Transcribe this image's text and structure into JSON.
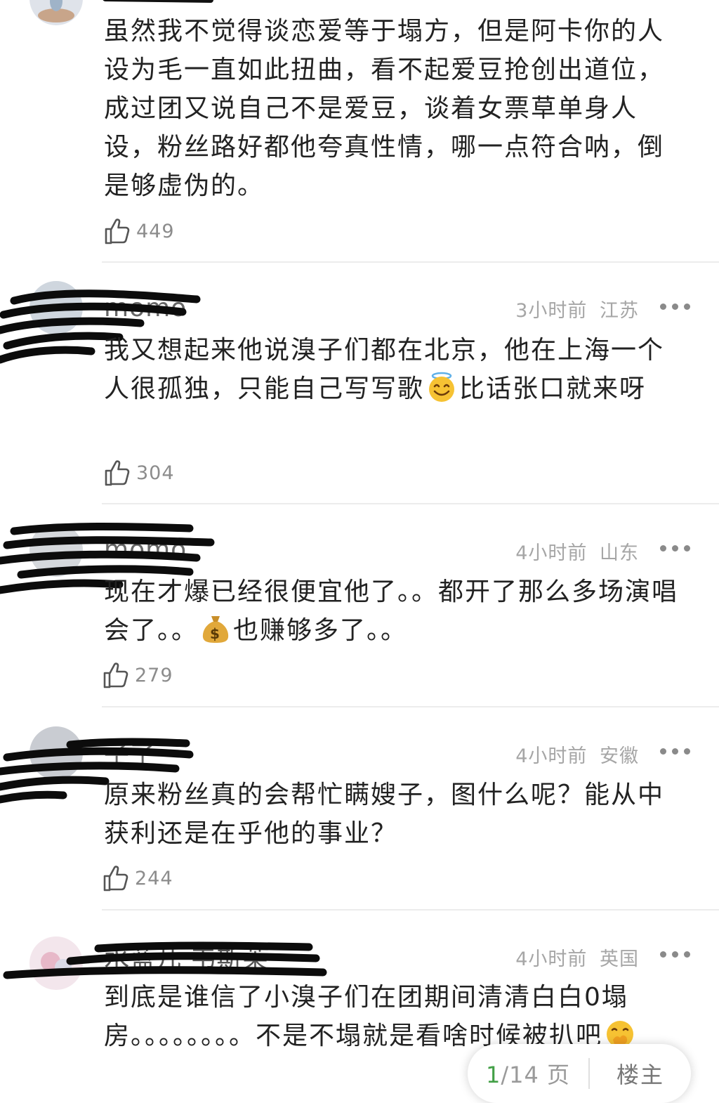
{
  "comments": [
    {
      "text": "虽然我不觉得谈恋爱等于塌方，但是阿卡你的人设为毛一直如此扭曲，看不起爱豆抢创出道位，成过团又说自己不是爱豆，谈着女票草单身人设，粉丝路好都他夸真性情，哪一点符合呐，倒是够虚伪的。",
      "likes": "449"
    },
    {
      "username": "momo",
      "time": "3小时前",
      "location": "江苏",
      "text_before": "我又想起来他说溴子们都在北京，他在上海一个人很孤独，只能自己写写歌",
      "emoji": "smiling-face-with-halo",
      "text_after": "比话张口就来呀",
      "likes": "304"
    },
    {
      "username": "momo",
      "time": "4小时前",
      "location": "山东",
      "text_before": "现在才爆已经很便宜他了。。都开了那么多场演唱会了。。",
      "emoji": "money-bag",
      "text_after": "也赚够多了。。",
      "likes": "279"
    },
    {
      "username": "子了",
      "time": "4小时前",
      "location": "安徽",
      "text": "原来粉丝真的会帮忙瞒嫂子，图什么呢？能从中获利还是在乎他的事业？",
      "likes": "244"
    },
    {
      "username": "水蓝儿 韦斯莱",
      "time": "4小时前",
      "location": "英国",
      "text_before": "到底是谁信了小溴子们在团期间清清白白0塌房。。。。。。。。不是不塌就是看啥时候被扒吧",
      "emoji": "face-with-hand-over-mouth"
    }
  ],
  "pager": {
    "current": "1",
    "total": "/14 页",
    "op_label": "楼主"
  },
  "colors": {
    "accent": "#43a047",
    "meta": "#a6a6a6",
    "divider": "#ececec"
  },
  "icons": [
    "thumbs-up-icon",
    "more-icon",
    "avatar"
  ]
}
